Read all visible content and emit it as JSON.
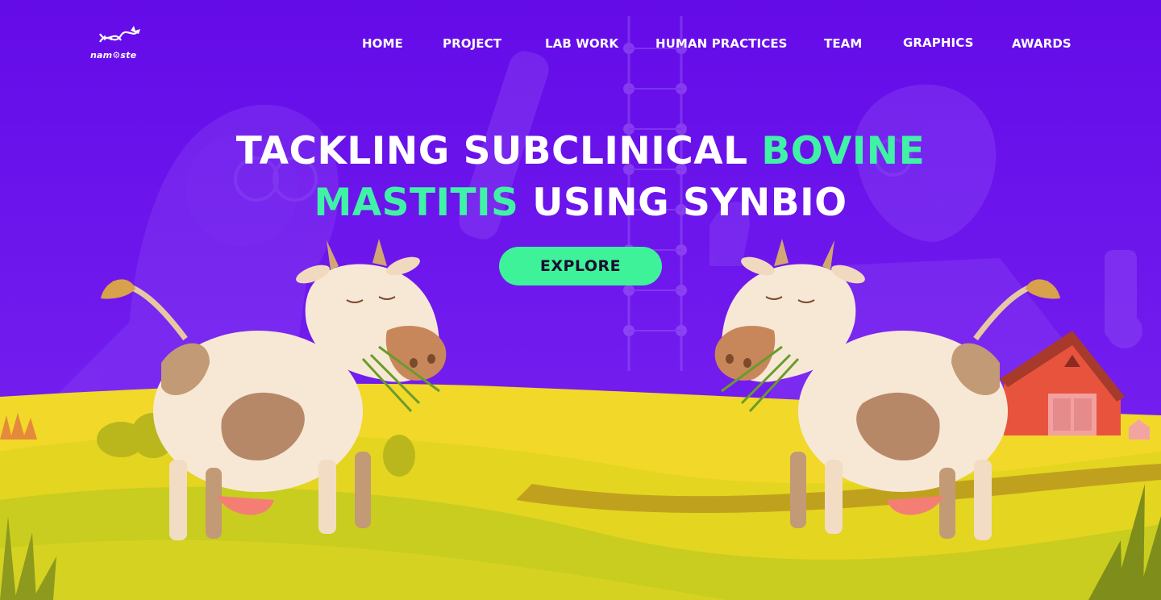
{
  "brand": {
    "logo_text": "nam⚙ste",
    "logo_icon": "dna-cow-icon"
  },
  "nav": {
    "items": [
      {
        "label": "HOME"
      },
      {
        "label": "PROJECT"
      },
      {
        "label": "LAB WORK"
      },
      {
        "label": "HUMAN PRACTICES"
      },
      {
        "label": "TEAM"
      },
      {
        "label": "GRAPHICS"
      },
      {
        "label": "AWARDS"
      }
    ]
  },
  "hero": {
    "title_part1": "TACKLING SUBCLINICAL ",
    "title_accent1": "BOVINE",
    "title_accent2": "MASTITIS",
    "title_part2": " USING SYNBIO",
    "cta_label": "EXPLORE"
  },
  "colors": {
    "background": "#6a0ee6",
    "accent": "#3ff2a6",
    "field": "#d7d421",
    "barn": "#e8533e"
  }
}
